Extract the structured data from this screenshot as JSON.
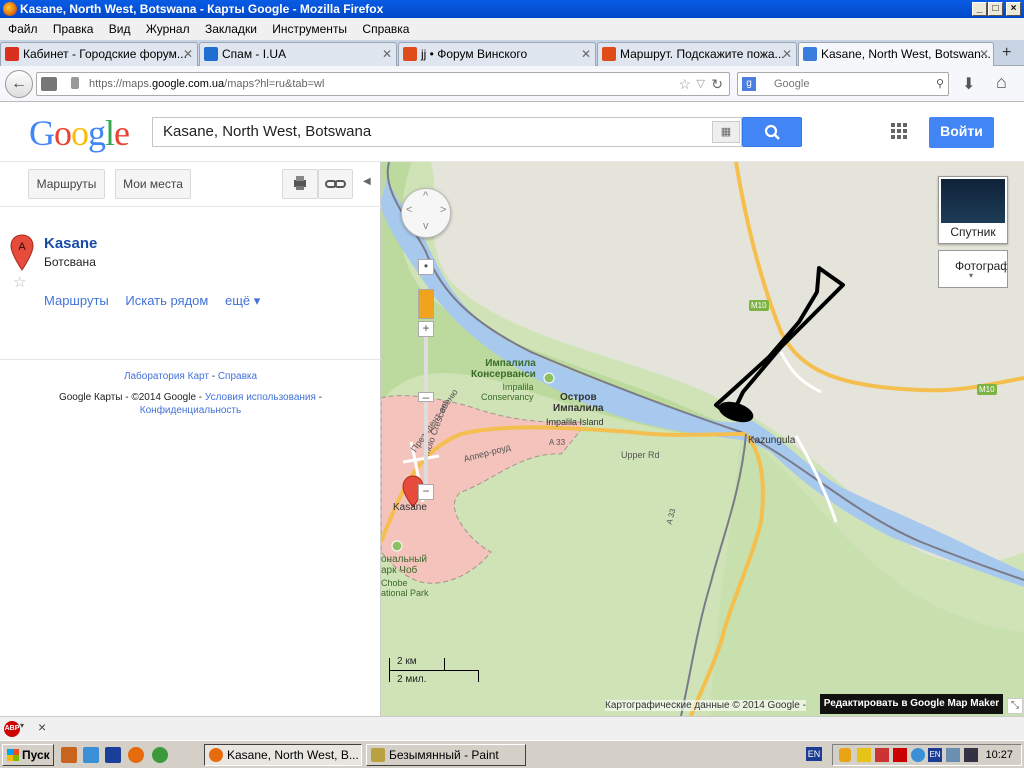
{
  "window": {
    "title": "Kasane, North West, Botswana - Карты Google - Mozilla Firefox"
  },
  "menu": [
    "Файл",
    "Правка",
    "Вид",
    "Журнал",
    "Закладки",
    "Инструменты",
    "Справка"
  ],
  "tabs": [
    {
      "label": "Кабинет - Городские форум...",
      "icon_color": "#d9301f"
    },
    {
      "label": "Спам - I.UA",
      "icon_color": "#1f6fd0"
    },
    {
      "label": "jj • Форум Винского",
      "icon_color": "#e04b1a"
    },
    {
      "label": "Маршрут. Подскажите пожа...",
      "icon_color": "#e04b1a"
    },
    {
      "label": "Kasane, North West, Botswan...",
      "icon_color": "#3b7ddd"
    }
  ],
  "nav": {
    "url_prefix": "https://maps.",
    "url_domain": "google.com.ua",
    "url_suffix": "/maps?hl=ru&tab=wl",
    "search_placeholder": "Google"
  },
  "google": {
    "search_query": "Kasane, North West, Botswana",
    "login_label": "Войти"
  },
  "panel": {
    "routes_btn": "Маршруты",
    "myplaces_btn": "Мои места",
    "place_marker": "A",
    "place_title": "Kasane",
    "place_sub": "Ботсвана",
    "link_routes": "Маршруты",
    "link_nearby": "Искать рядом",
    "link_more": "ещё ▾",
    "footer_lab": "Лаборатория Карт",
    "footer_sep": " - ",
    "footer_help": "Справка",
    "footer_line2": "Google Карты - ©2014 Google - ",
    "footer_terms": "Условия использования",
    "footer_dash": " -",
    "footer_privacy": "Конфиденциальность"
  },
  "map": {
    "satellite_label": "Спутник",
    "photo_label": "Фотографии",
    "labels": {
      "impalila_cons": "Импалила\nКонсерванси",
      "impalila_cons_en": "Impalila\nConservancy",
      "ostrov": "Остров\nИмпалила",
      "impalila_island": "Impalila Island",
      "kazungula": "Kazungula",
      "kasane": "Kasane",
      "m10a": "M10",
      "m10b": "M10",
      "a33a": "A 33",
      "a33b": "A 33",
      "upper_rd": "Upper Rd",
      "apper_road": "Аппер-роуд",
      "crescent": "molo Crescent",
      "prezident": "Президент-авеню",
      "chobe_ru": "ональный\nарк Чоб",
      "chobe_en": "Chobe\national Park"
    },
    "scale_km": "2 км",
    "scale_mi": "2 мил.",
    "copyright": "Картографические данные © 2014 Google -",
    "map_maker": "Редактировать в Google Map Maker"
  },
  "taskbar": {
    "start_label": "Пуск",
    "items": [
      "Kasane, North West, B...",
      "Безымянный - Paint"
    ],
    "lang": "EN",
    "tray_lang": "EN",
    "clock": "10:27"
  },
  "addon": {
    "abp": "ABP"
  }
}
